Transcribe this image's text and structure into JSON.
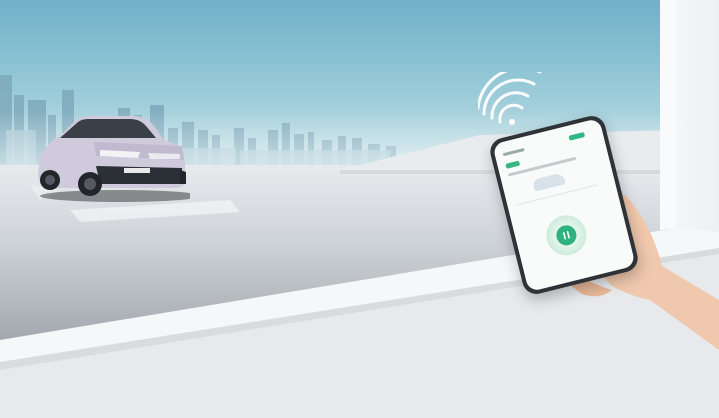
{
  "image": {
    "subject": "smart-car-remote-app",
    "colors": {
      "sky_top": "#6fb0c8",
      "accent_green": "#2fb27d",
      "car_body": "#cfcbdc",
      "phone_frame": "#2f3236"
    }
  },
  "phone_app": {
    "action_button_icon": "power-icon",
    "signal_icon": "wifi-signal-icon"
  }
}
